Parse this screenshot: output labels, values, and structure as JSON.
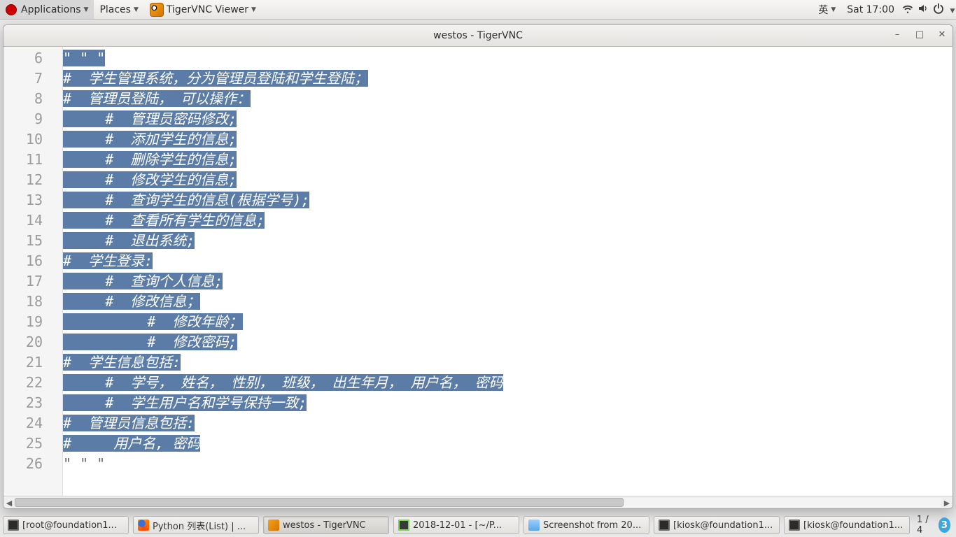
{
  "topbar": {
    "applications": "Applications",
    "places": "Places",
    "vnc_app": "TigerVNC Viewer",
    "ime": "英",
    "clock": "Sat 17:00"
  },
  "window": {
    "title": "westos - TigerVNC"
  },
  "editor": {
    "first_line": 6,
    "lines": [
      {
        "sel": "\" \" \"",
        "plain": ""
      },
      {
        "sel": "#  学生管理系统，分为管理员登陆和学生登陆；",
        "plain": ""
      },
      {
        "sel": "#  管理员登陆， 可以操作：",
        "plain": ""
      },
      {
        "sel": "     #  管理员密码修改;",
        "plain": ""
      },
      {
        "sel": "     #  添加学生的信息;",
        "plain": ""
      },
      {
        "sel": "     #  删除学生的信息;",
        "plain": ""
      },
      {
        "sel": "     #  修改学生的信息;",
        "plain": ""
      },
      {
        "sel": "     #  查询学生的信息(根据学号);",
        "plain": ""
      },
      {
        "sel": "     #  查看所有学生的信息;",
        "plain": ""
      },
      {
        "sel": "     #  退出系统;",
        "plain": ""
      },
      {
        "sel": "#  学生登录:",
        "plain": ""
      },
      {
        "sel": "     #  查询个人信息;",
        "plain": ""
      },
      {
        "sel": "     #  修改信息；",
        "plain": ""
      },
      {
        "sel": "          #  修改年龄；",
        "plain": ""
      },
      {
        "sel": "          #  修改密码;",
        "plain": ""
      },
      {
        "sel": "#  学生信息包括:",
        "plain": ""
      },
      {
        "sel": "     #  学号， 姓名， 性别， 班级， 出生年月， 用户名， 密码",
        "plain": ""
      },
      {
        "sel": "     #  学生用户名和学号保持一致;",
        "plain": ""
      },
      {
        "sel": "#  管理员信息包括:",
        "plain": ""
      },
      {
        "sel": "#     用户名, 密码",
        "plain": ""
      },
      {
        "sel": "",
        "plain": "\" \" \""
      }
    ]
  },
  "taskbar": {
    "items": [
      {
        "label": "[root@foundation1...",
        "icon": "term",
        "active": false
      },
      {
        "label": "Python 列表(List) | ...",
        "icon": "ff",
        "active": false
      },
      {
        "label": "westos - TigerVNC",
        "icon": "vnc",
        "active": true
      },
      {
        "label": "2018-12-01 - [~/P...",
        "icon": "pc",
        "active": false
      },
      {
        "label": "Screenshot from 20...",
        "icon": "img",
        "active": false
      },
      {
        "label": "[kiosk@foundation1...",
        "icon": "term",
        "active": false
      },
      {
        "label": "[kiosk@foundation1...",
        "icon": "term",
        "active": false
      }
    ],
    "workspace": "1 / 4",
    "badge": "3"
  }
}
